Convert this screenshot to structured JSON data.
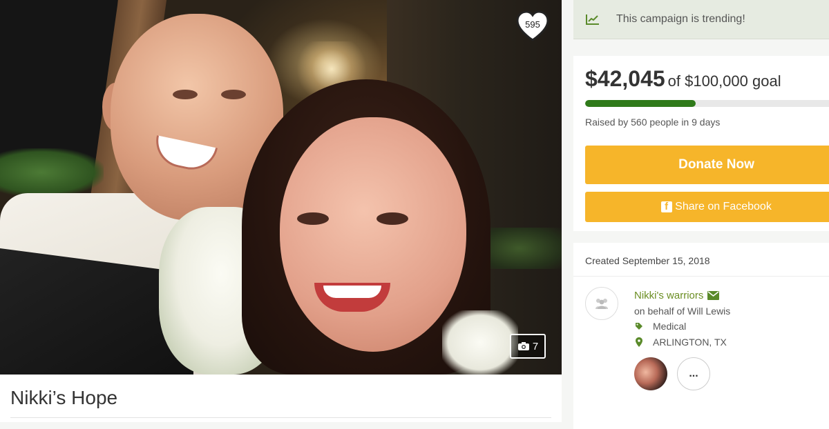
{
  "hero": {
    "heart_count": "595",
    "photo_count": "7"
  },
  "campaign": {
    "title": "Nikki’s Hope"
  },
  "sidebar": {
    "trending_text": "This campaign is trending!",
    "amount": "$42,045",
    "goal_text": "of $100,000 goal",
    "progress_fraction": 0.42,
    "raised_text": "Raised by 560 people in 9 days",
    "donate_label": "Donate Now",
    "share_label": "Share on Facebook",
    "created_text": "Created September 15, 2018",
    "organizer_name": "Nikki's warriors",
    "behalf_text": "on behalf of Will Lewis",
    "category": "Medical",
    "location": "ARLINGTON, TX",
    "more_label": "..."
  },
  "colors": {
    "accent_green": "#2f7a1a",
    "button_orange": "#f6b52a",
    "link_green": "#6b8e23"
  },
  "icons": [
    "heart-icon",
    "camera-icon",
    "trending-chart-icon",
    "facebook-icon",
    "envelope-icon",
    "tag-icon",
    "map-marker-icon",
    "user-group-icon"
  ]
}
